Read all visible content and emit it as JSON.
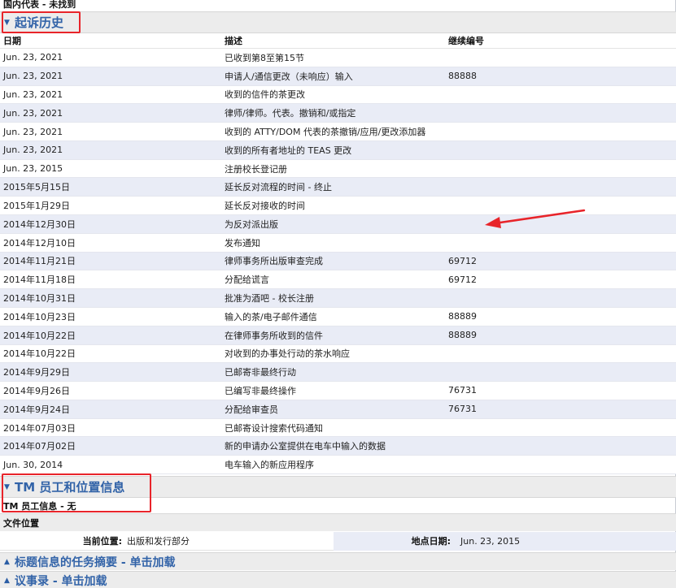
{
  "top_note": "国内代表 - 未找到",
  "prosecution": {
    "title": "起诉历史",
    "columns": {
      "date": "日期",
      "desc": "描述",
      "num": "继续编号"
    },
    "rows": [
      {
        "date": "Jun. 23, 2021",
        "desc": "已收到第8至第15节",
        "num": ""
      },
      {
        "date": "Jun. 23, 2021",
        "desc": "申请人/通信更改（未响应）输入",
        "num": "88888"
      },
      {
        "date": "Jun. 23, 2021",
        "desc": "收到的信件的茶更改",
        "num": ""
      },
      {
        "date": "Jun. 23, 2021",
        "desc": "律师/律师。代表。撤销和/或指定",
        "num": ""
      },
      {
        "date": "Jun. 23, 2021",
        "desc": "收到的 ATTY/DOM 代表的茶撤销/应用/更改添加器",
        "num": ""
      },
      {
        "date": "Jun. 23, 2021",
        "desc": "收到的所有者地址的 TEAS 更改",
        "num": ""
      },
      {
        "date": "Jun. 23, 2015",
        "desc": "注册校长登记册",
        "num": ""
      },
      {
        "date": "2015年5月15日",
        "desc": "延长反对流程的时间 - 终止",
        "num": ""
      },
      {
        "date": "2015年1月29日",
        "desc": "延长反对接收的时间",
        "num": ""
      },
      {
        "date": "2014年12月30日",
        "desc": "为反对派出版",
        "num": ""
      },
      {
        "date": "2014年12月10日",
        "desc": "发布通知",
        "num": ""
      },
      {
        "date": "2014年11月21日",
        "desc": "律师事务所出版审查完成",
        "num": "69712"
      },
      {
        "date": "2014年11月18日",
        "desc": "分配给谎言",
        "num": "69712"
      },
      {
        "date": "2014年10月31日",
        "desc": "批准为酒吧 - 校长注册",
        "num": ""
      },
      {
        "date": "2014年10月23日",
        "desc": "输入的茶/电子邮件通信",
        "num": "88889"
      },
      {
        "date": "2014年10月22日",
        "desc": "在律师事务所收到的信件",
        "num": "88889"
      },
      {
        "date": "2014年10月22日",
        "desc": "对收到的办事处行动的茶水响应",
        "num": ""
      },
      {
        "date": "2014年9月29日",
        "desc": "已邮寄非最终行动",
        "num": ""
      },
      {
        "date": "2014年9月26日",
        "desc": "已编写非最终操作",
        "num": "76731"
      },
      {
        "date": "2014年9月24日",
        "desc": "分配给审查员",
        "num": "76731"
      },
      {
        "date": "2014年07月03日",
        "desc": "已邮寄设计搜索代码通知",
        "num": ""
      },
      {
        "date": "2014年07月02日",
        "desc": "新的申请办公室提供在电车中输入的数据",
        "num": ""
      },
      {
        "date": "Jun. 30, 2014",
        "desc": "电车输入的新应用程序",
        "num": ""
      }
    ]
  },
  "staff": {
    "title": "TM 员工和位置信息",
    "staff_info": "TM 员工信息 - 无",
    "file_location_label": "文件位置",
    "current_location_label": "当前位置:",
    "current_location_value": "出版和发行部分",
    "location_date_label": "地点日期:",
    "location_date_value": "Jun. 23, 2015"
  },
  "collapsed_sections": [
    {
      "title": "标题信息的任务摘要 - 单击加载"
    },
    {
      "title": "议事录 - 单击加载"
    }
  ],
  "icons": {
    "expanded": "triangle-down-icon",
    "collapsed": "triangle-up-icon"
  },
  "colors": {
    "accent": "#3263a8",
    "annotation": "#e8242a",
    "row_alt": "#e9ecf6"
  }
}
